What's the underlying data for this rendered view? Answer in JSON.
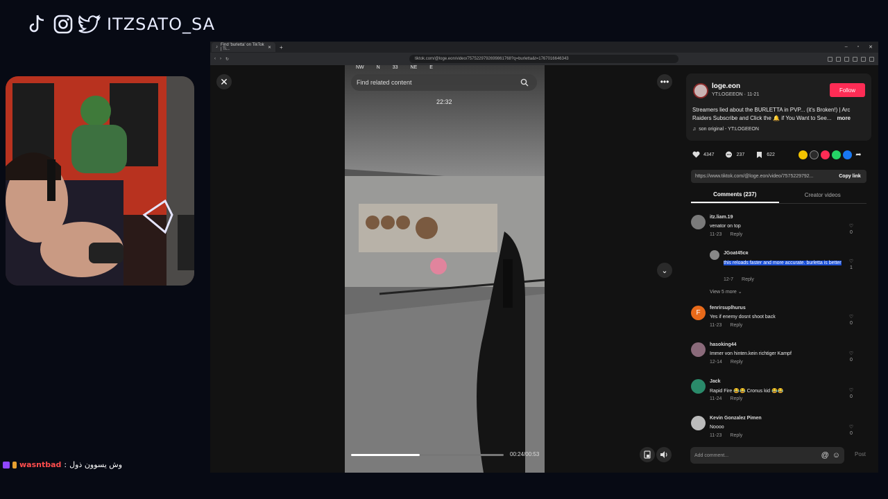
{
  "overlay": {
    "handle": "ITZSATO_SA",
    "icons": [
      "tiktok-icon",
      "instagram-icon",
      "twitter-icon"
    ],
    "chat": {
      "user": "wasntbad",
      "separator": ":",
      "message": "وش يسوون ذول"
    }
  },
  "browser": {
    "tab_title": "Find 'burletta' on TikTok | Ti...",
    "url": "tiktok.com/@loge.eon/video/7575229792699861768?q=burletta&t=1767016646343"
  },
  "video": {
    "search_placeholder": "Find related content",
    "compass": [
      "NW",
      "N",
      "33",
      "NE",
      "E"
    ],
    "timer": "22:32",
    "time": "00:24/00:53",
    "progress": 0.45
  },
  "author": {
    "name": "loge.eon",
    "sub": "YT:LOGEEON · 11-21",
    "follow": "Follow",
    "description": "Streamers lied about the BURLETTA in PVP... (it's Broken!) | Arc Raiders Subscribe and Click the 🔔 if You Want to See...",
    "more": "more",
    "sound": "son original - YT:LOGEEON"
  },
  "stats": {
    "likes": "4347",
    "comments": "237",
    "saves": "622"
  },
  "share": {
    "link": "https://www.tiktok.com/@loge.eon/video/7575229792...",
    "copy": "Copy link"
  },
  "tabs": {
    "comments": "Comments (237)",
    "creator": "Creator videos"
  },
  "comments": [
    {
      "user": "itz.liam.19",
      "text": "venator on top",
      "date": "11-23",
      "reply": "Reply",
      "likes": "0"
    },
    {
      "user": "fenrirsuplhurus",
      "text": "Yes if enemy dosnt shoot back",
      "date": "11-23",
      "reply": "Reply",
      "likes": "0",
      "initial": "F"
    },
    {
      "user": "hasoking44",
      "text": "Immer von hinten.kein richtiger Kampf",
      "date": "12-14",
      "reply": "Reply",
      "likes": "0"
    },
    {
      "user": "Jack",
      "text": "Rapid Fire 😂😂 Cronus kid 😂😂",
      "date": "11-24",
      "reply": "Reply",
      "likes": "0"
    },
    {
      "user": "Kevin Gonzalez Pimen",
      "text": "Noooo",
      "date": "11-23",
      "reply": "Reply",
      "likes": "0"
    }
  ],
  "reply": {
    "user": "JGoat45ᴄʀ",
    "text": "this reloads faster and more accurate. burletta is better",
    "date": "12-7",
    "reply": "Reply",
    "likes": "1"
  },
  "view_more": "View 5 more",
  "input": {
    "placeholder": "Add comment...",
    "post": "Post"
  },
  "colors": {
    "accent": "#fe2c55",
    "selection": "#1a4fd6",
    "background": "#070a14"
  }
}
